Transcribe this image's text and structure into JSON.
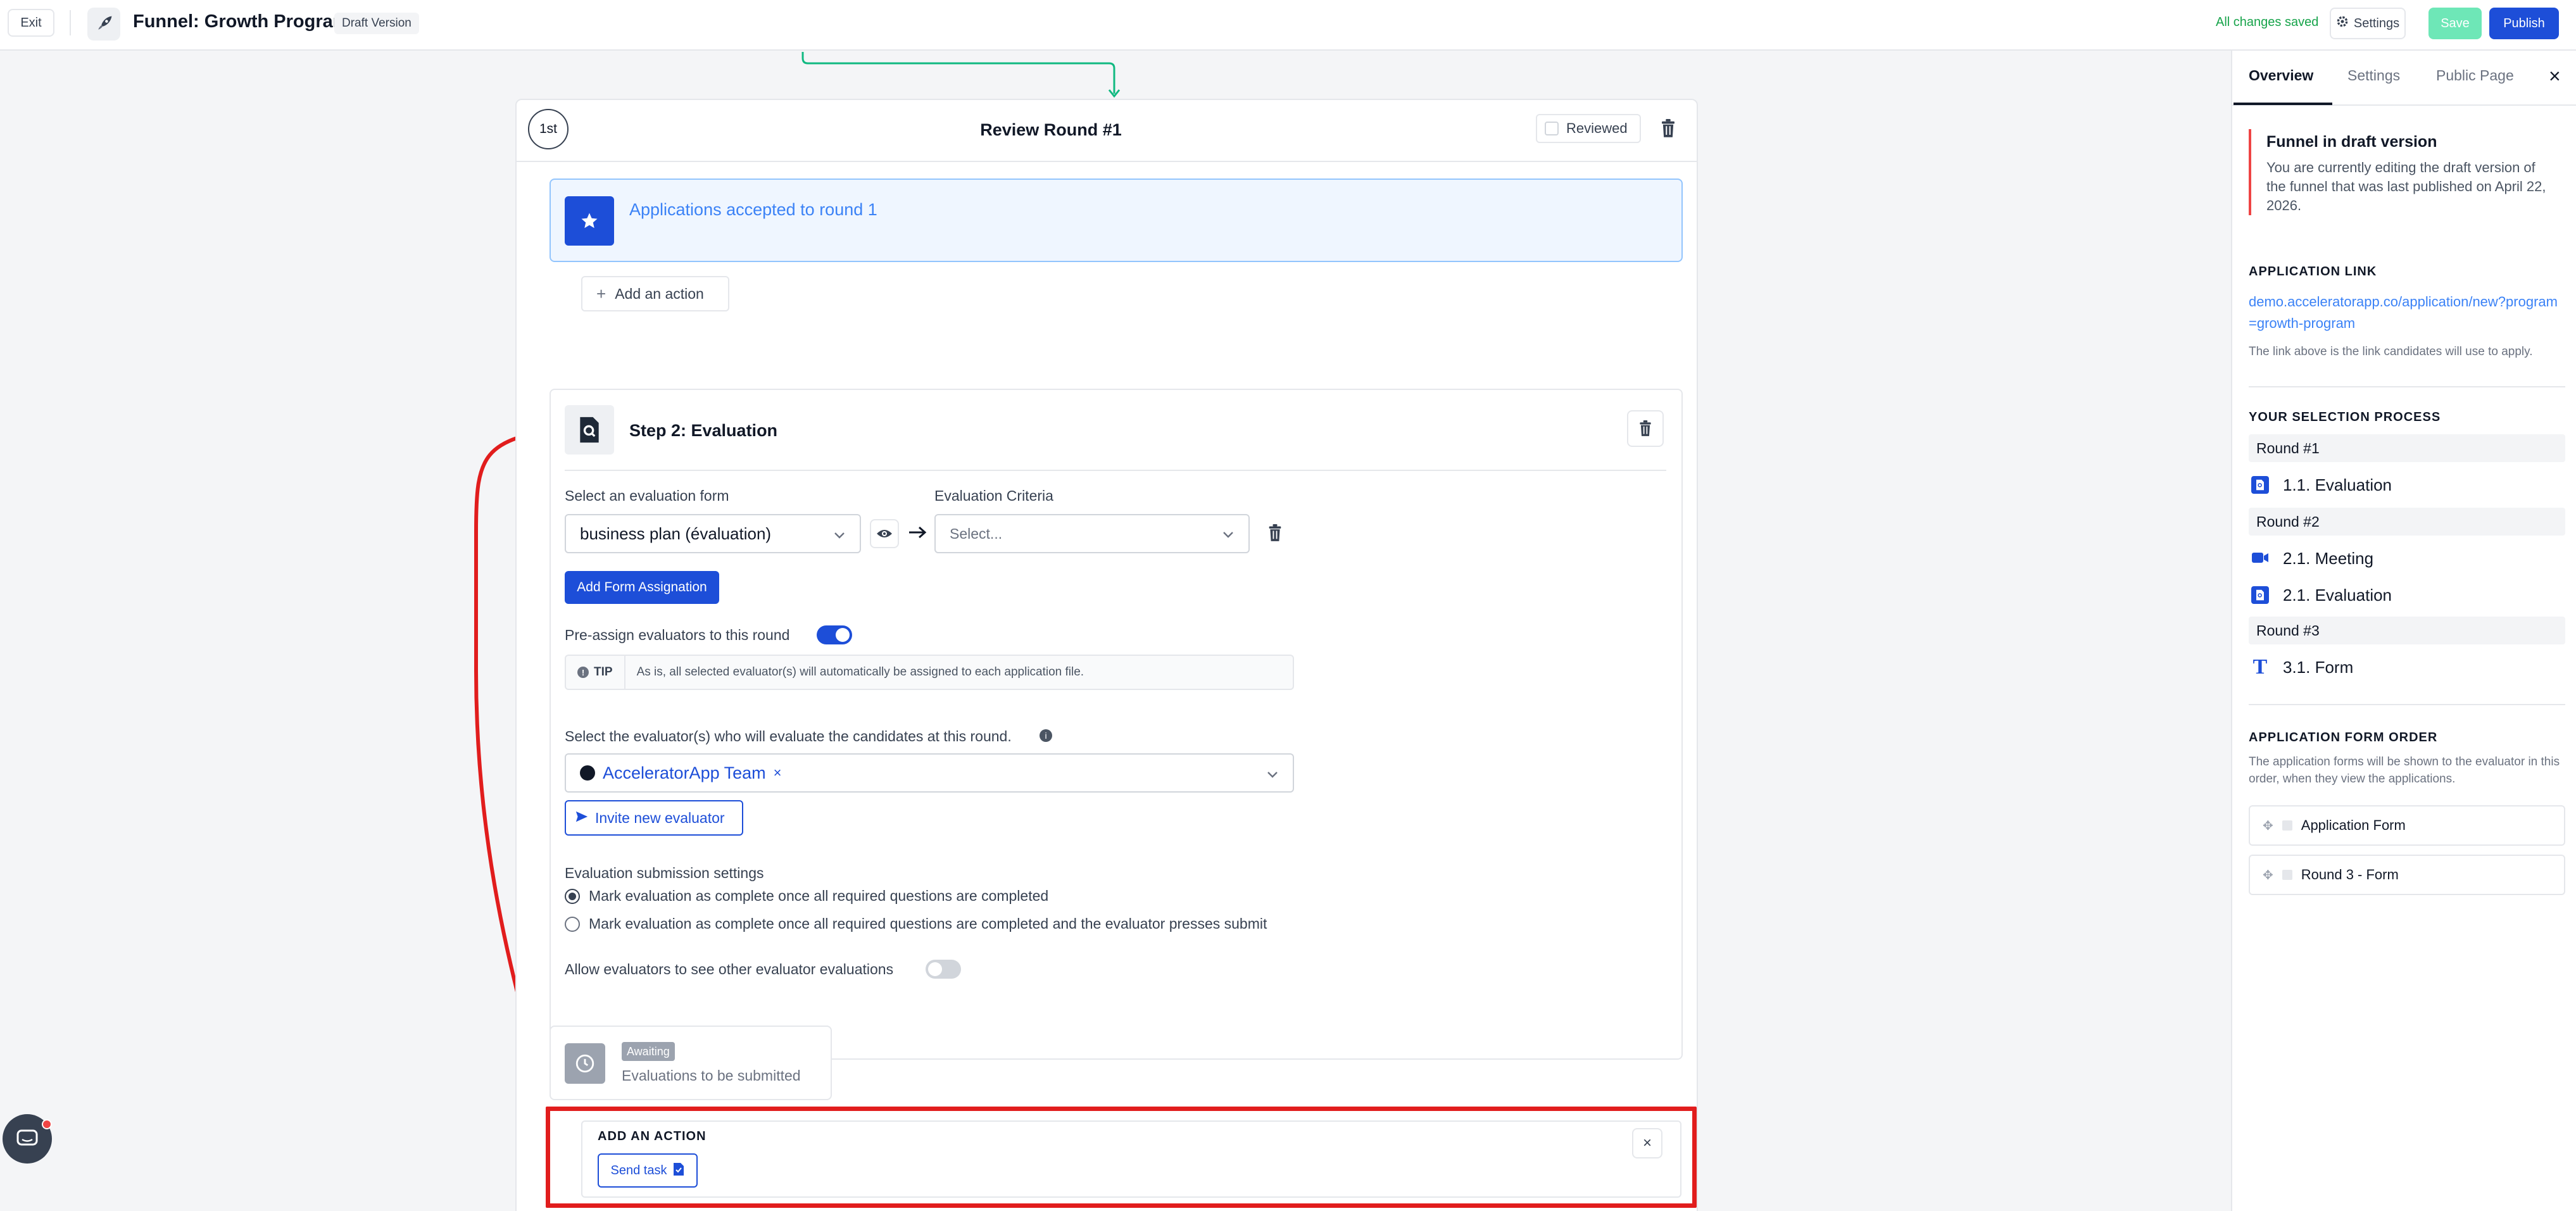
{
  "header": {
    "exit_label": "Exit",
    "title": "Funnel: Growth Program",
    "badge": "Draft Version",
    "saved_status": "All changes saved",
    "settings_label": "Settings",
    "save_label": "Save",
    "publish_label": "Publish"
  },
  "round": {
    "ordinal": "1st",
    "title": "Review Round #1",
    "reviewed_label": "Reviewed"
  },
  "accepted_block": {
    "title": "Applications accepted to round 1",
    "add_action_label": "Add an action"
  },
  "step": {
    "title": "Step 2: Evaluation",
    "form_label": "Select an evaluation form",
    "form_value": "business plan (évaluation)",
    "criteria_label": "Evaluation Criteria",
    "criteria_placeholder": "Select...",
    "add_form_button": "Add Form Assignation",
    "preassign_label": "Pre-assign evaluators to this round",
    "preassign_on": true,
    "tip_tag": "TIP",
    "tip_text": "As is, all selected evaluator(s) will automatically be assigned to each application file.",
    "evaluators_label": "Select the evaluator(s) who will evaluate the candidates at this round.",
    "evaluator_chip": "AcceleratorApp Team",
    "chip_remove": "×",
    "invite_button": "Invite new evaluator",
    "submission_label": "Evaluation submission settings",
    "radio_options": [
      "Mark evaluation as complete once all required questions are completed",
      "Mark evaluation as complete once all required questions are completed and the evaluator presses submit"
    ],
    "radio_selected": 0,
    "allow_see_label": "Allow evaluators to see other evaluator evaluations",
    "allow_see_on": false
  },
  "awaiting": {
    "badge": "Awaiting",
    "text": "Evaluations to be submitted"
  },
  "add_action_panel": {
    "title": "ADD AN ACTION",
    "close": "×",
    "send_task_label": "Send task"
  },
  "panel": {
    "tabs": [
      "Overview",
      "Settings",
      "Public Page"
    ],
    "close": "×",
    "draft_title": "Funnel in draft version",
    "draft_text": "You are currently editing the draft version of the funnel that was last published on April 22, 2026.",
    "app_link_head": "APPLICATION LINK",
    "app_link": "demo.acceleratorapp.co/application/new?program=growth-program",
    "app_link_note": "The link above is the link candidates will use to apply.",
    "selection_head": "YOUR SELECTION PROCESS",
    "rounds": [
      {
        "name": "Round #1",
        "items": [
          {
            "icon": "document-search-icon",
            "label": "1.1. Evaluation"
          }
        ]
      },
      {
        "name": "Round #2",
        "items": [
          {
            "icon": "video-camera-icon",
            "label": "2.1. Meeting"
          },
          {
            "icon": "document-search-icon",
            "label": "2.1. Evaluation"
          }
        ]
      },
      {
        "name": "Round #3",
        "items": [
          {
            "icon": "text-t-icon",
            "label": "3.1. Form"
          }
        ]
      }
    ],
    "order_head": "APPLICATION FORM ORDER",
    "order_note": "The application forms will be shown to the evaluator in this order, when they view the applications.",
    "order_items": [
      "Application Form",
      "Round 3 - Form"
    ]
  },
  "colors": {
    "primary": "#1d4ed8",
    "success": "#16a34a",
    "save_disabled": "#6ee7b7",
    "annotation_red": "#e11d1d",
    "connector_green": "#10b981"
  }
}
